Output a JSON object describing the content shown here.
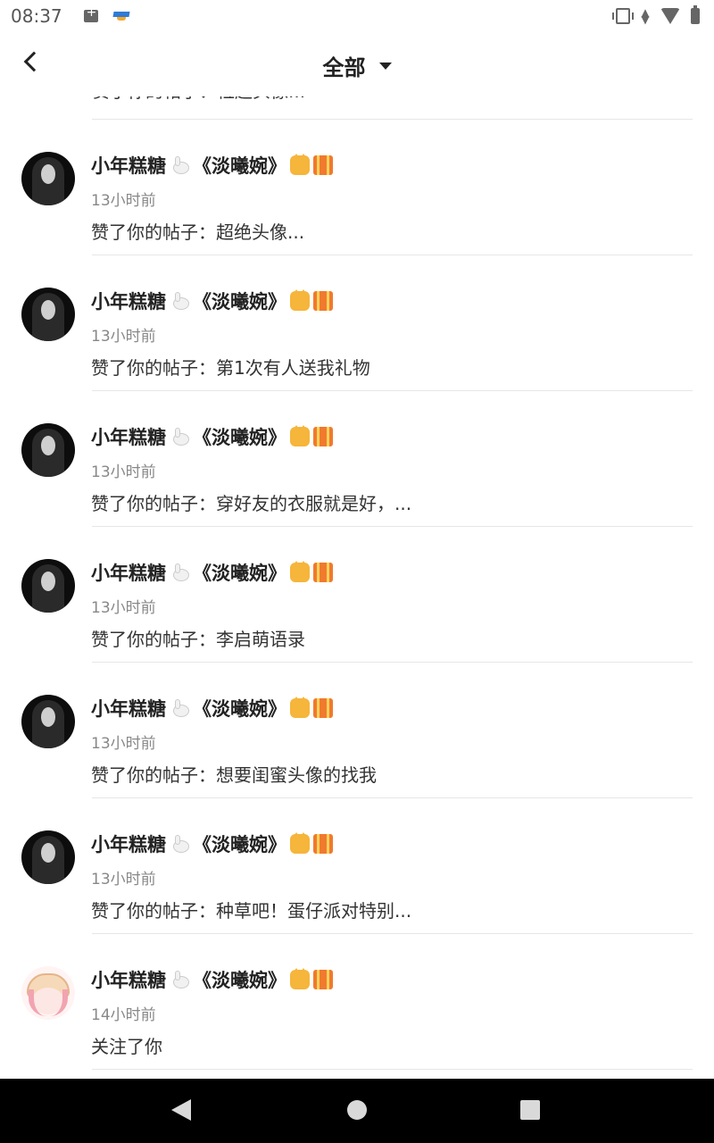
{
  "status_bar": {
    "time": "08:37"
  },
  "header": {
    "title": "全部"
  },
  "partial_item": {
    "text": "赞了你的帖子：粒超头像..."
  },
  "items": [
    {
      "name": "小年糕糖",
      "name_suffix": "《淡曦婉》",
      "time": "13小时前",
      "content": "赞了你的帖子：超绝头像...",
      "avatar": "dark"
    },
    {
      "name": "小年糕糖",
      "name_suffix": "《淡曦婉》",
      "time": "13小时前",
      "content": "赞了你的帖子：第1次有人送我礼物",
      "avatar": "dark"
    },
    {
      "name": "小年糕糖",
      "name_suffix": "《淡曦婉》",
      "time": "13小时前",
      "content": "赞了你的帖子：穿好友的衣服就是好，...",
      "avatar": "dark"
    },
    {
      "name": "小年糕糖",
      "name_suffix": "《淡曦婉》",
      "time": "13小时前",
      "content": "赞了你的帖子：李启萌语录",
      "avatar": "dark"
    },
    {
      "name": "小年糕糖",
      "name_suffix": "《淡曦婉》",
      "time": "13小时前",
      "content": "赞了你的帖子：想要闺蜜头像的找我",
      "avatar": "dark"
    },
    {
      "name": "小年糕糖",
      "name_suffix": "《淡曦婉》",
      "time": "13小时前",
      "content": "赞了你的帖子：种草吧！蛋仔派对特别...",
      "avatar": "dark"
    },
    {
      "name": "小年糕糖",
      "name_suffix": "《淡曦婉》",
      "time": "14小时前",
      "content": "关注了你",
      "avatar": "cute"
    }
  ]
}
